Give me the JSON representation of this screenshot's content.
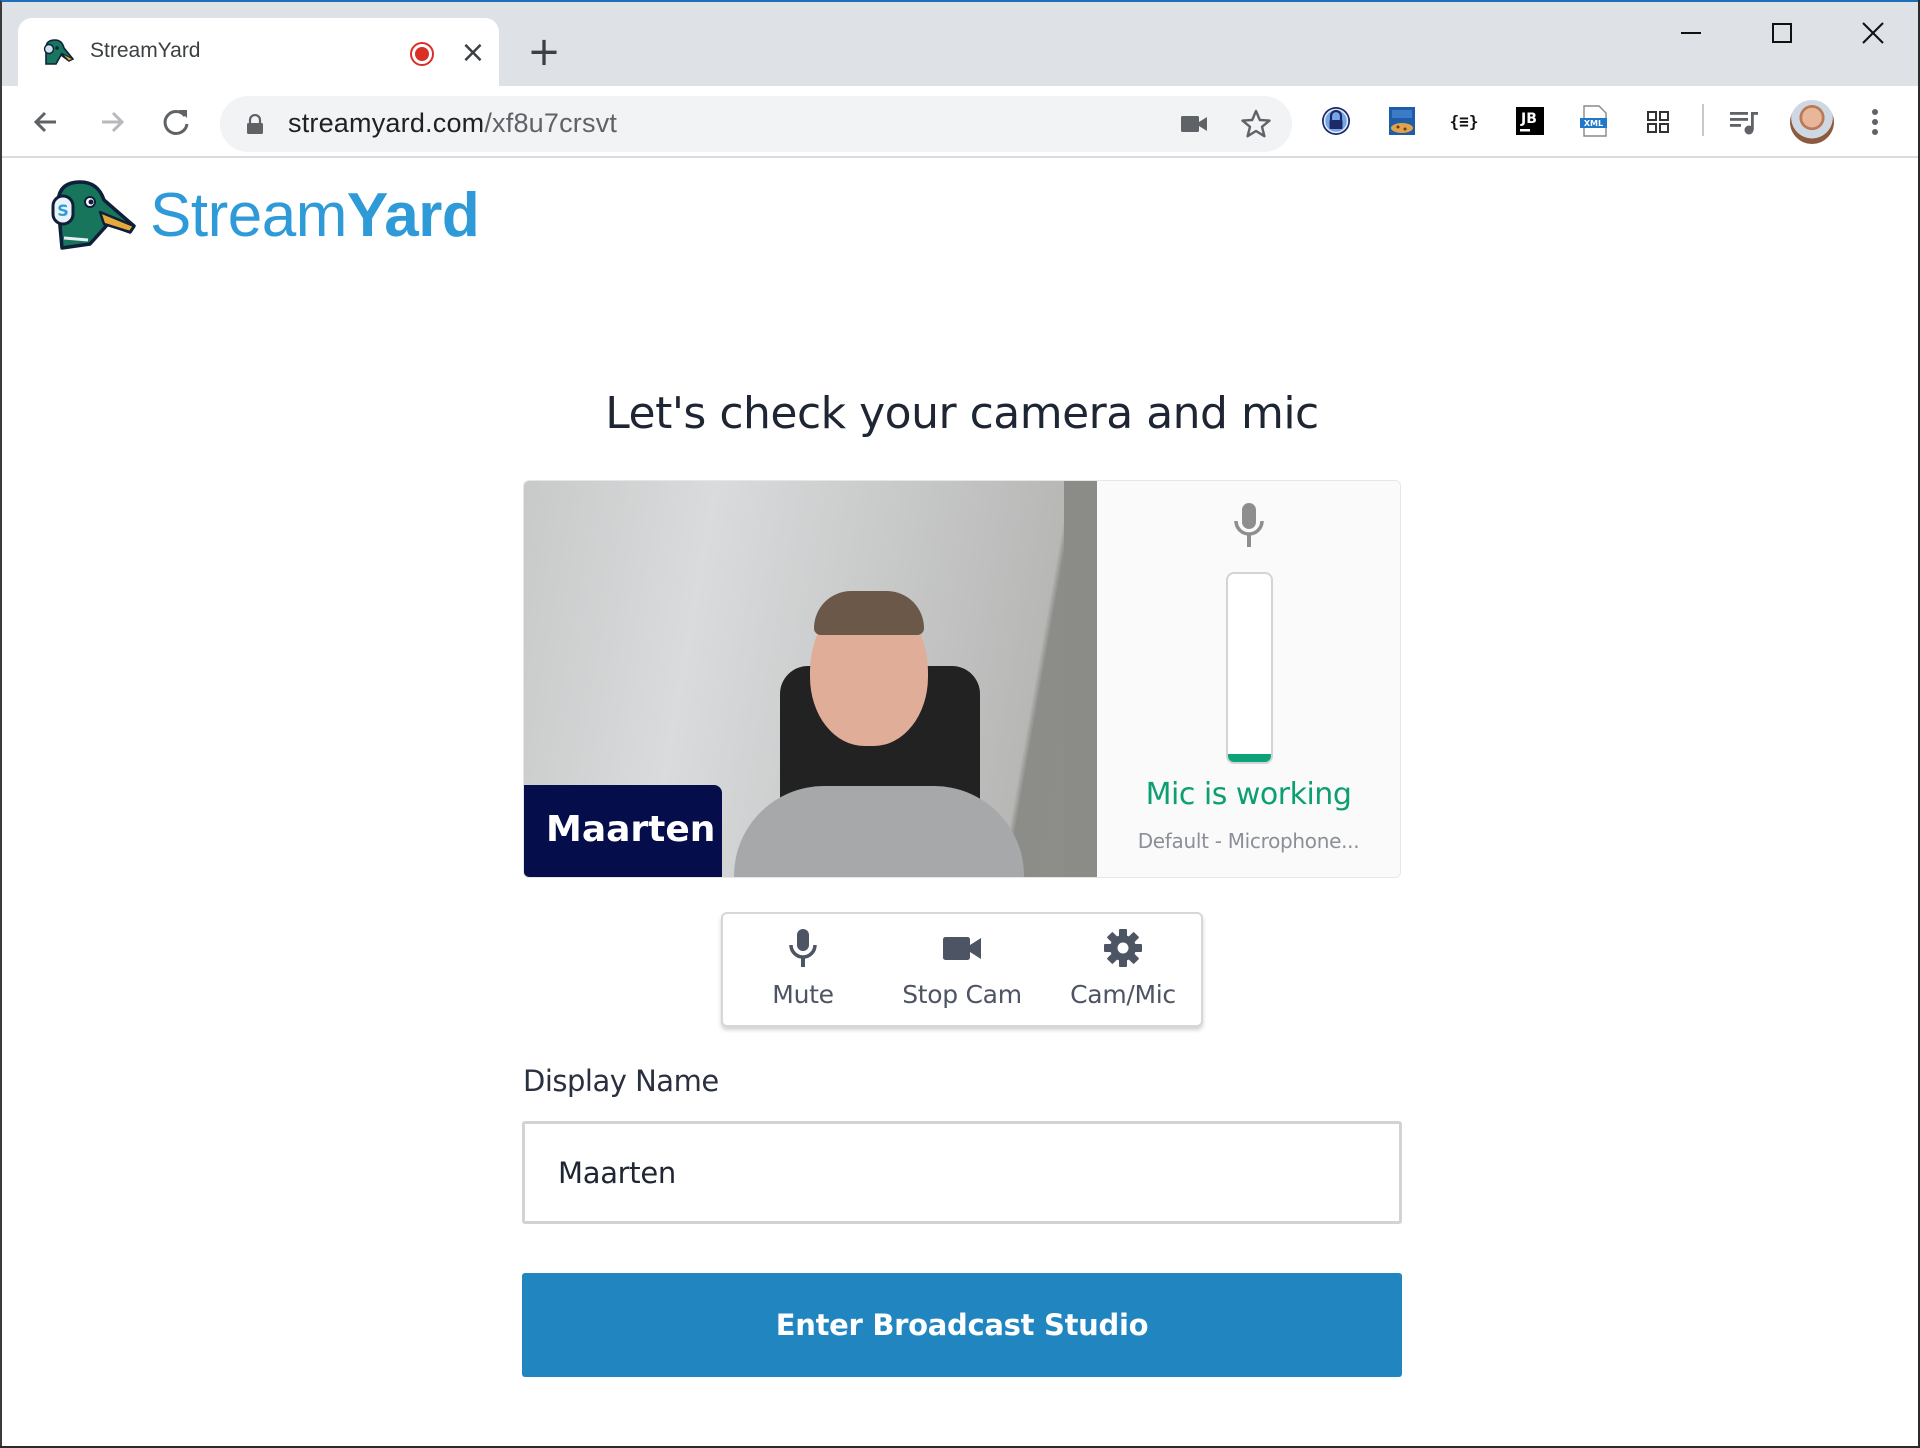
{
  "browser": {
    "tab": {
      "title": "StreamYard",
      "recording_indicator": "recording-dot-icon",
      "close_glyph": "×"
    },
    "new_tab_glyph": "+",
    "window_controls": [
      "minimize",
      "maximize",
      "close"
    ],
    "toolbar": {
      "nav": [
        "back",
        "forward",
        "reload"
      ],
      "url_host": "streamyard.com",
      "url_path": "/xf8u7crsvt",
      "omnibox_icons": [
        "camera-in-use-icon",
        "bookmark-star-icon"
      ],
      "extensions": [
        "password-lock-extension",
        "cookie-inspector-extension",
        "json-formatter-extension",
        "jetbrains-extension",
        "xml-viewer-extension",
        "apps-grid-extension",
        "media-queue-extension"
      ],
      "menu_glyph": "⋮"
    }
  },
  "page": {
    "logo": {
      "text_light": "Stream",
      "text_bold": "Yard"
    },
    "heading": "Let's check your camera and mic",
    "preview": {
      "name_tag": "Maarten",
      "mic_status": "Mic is working",
      "mic_device": "Default - Microphone...",
      "mic_level_percent": 4
    },
    "controls": [
      {
        "label": "Mute",
        "icon": "microphone-icon"
      },
      {
        "label": "Stop Cam",
        "icon": "video-camera-icon"
      },
      {
        "label": "Cam/Mic",
        "icon": "gear-icon"
      }
    ],
    "display_name": {
      "label": "Display Name",
      "value": "Maarten"
    },
    "enter_button": "Enter Broadcast Studio"
  },
  "colors": {
    "brand_blue": "#2e9ad8",
    "button_blue": "#2185c0",
    "mic_green": "#0d9e72",
    "name_tag_navy": "#050d4a",
    "record_red": "#d93025"
  }
}
